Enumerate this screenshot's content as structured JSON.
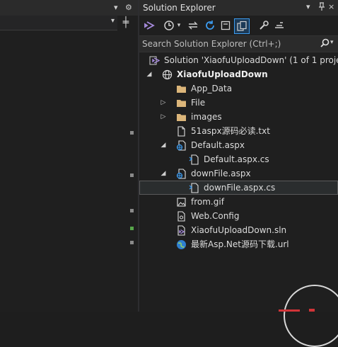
{
  "left_pane": {
    "markers": [
      "#8a8a8a",
      "#8a8a8a",
      "#8a8a8a",
      "#57a64a",
      "#8a8a8a"
    ]
  },
  "solution_explorer": {
    "title": "Solution Explorer",
    "search_placeholder": "Search Solution Explorer (Ctrl+;)",
    "tree": [
      {
        "label": "Solution 'XiaofuUploadDown' (1 of 1 proje",
        "icon": "solution-icon",
        "level": 0,
        "expander": "none",
        "bold": false,
        "selected": false
      },
      {
        "label": "XiaofuUploadDown",
        "icon": "globe-project-icon",
        "level": 0,
        "expander": "expanded",
        "bold": true,
        "selected": false
      },
      {
        "label": "App_Data",
        "icon": "folder-icon",
        "level": 1,
        "expander": "none",
        "bold": false,
        "selected": false
      },
      {
        "label": "File",
        "icon": "folder-icon",
        "level": 1,
        "expander": "collapsed",
        "bold": false,
        "selected": false
      },
      {
        "label": "images",
        "icon": "folder-icon",
        "level": 1,
        "expander": "collapsed",
        "bold": false,
        "selected": false
      },
      {
        "label": "51aspx源码必读.txt",
        "icon": "text-file-icon",
        "level": 1,
        "expander": "none",
        "bold": false,
        "selected": false
      },
      {
        "label": "Default.aspx",
        "icon": "web-form-icon",
        "level": 1,
        "expander": "expanded",
        "bold": false,
        "selected": false
      },
      {
        "label": "Default.aspx.cs",
        "icon": "code-file-icon",
        "level": 2,
        "expander": "none",
        "bold": false,
        "selected": false
      },
      {
        "label": "downFile.aspx",
        "icon": "web-form-icon",
        "level": 1,
        "expander": "expanded",
        "bold": false,
        "selected": false
      },
      {
        "label": "downFile.aspx.cs",
        "icon": "code-file-icon",
        "level": 2,
        "expander": "none",
        "bold": false,
        "selected": true
      },
      {
        "label": "from.gif",
        "icon": "image-file-icon",
        "level": 1,
        "expander": "none",
        "bold": false,
        "selected": false
      },
      {
        "label": "Web.Config",
        "icon": "config-file-icon",
        "level": 1,
        "expander": "none",
        "bold": false,
        "selected": false
      },
      {
        "label": "XiaofuUploadDown.sln",
        "icon": "sln-file-icon",
        "level": 1,
        "expander": "none",
        "bold": false,
        "selected": false
      },
      {
        "label": "最新Asp.Net源码下载.url",
        "icon": "internet-shortcut-icon",
        "level": 1,
        "expander": "none",
        "bold": false,
        "selected": false
      }
    ]
  }
}
